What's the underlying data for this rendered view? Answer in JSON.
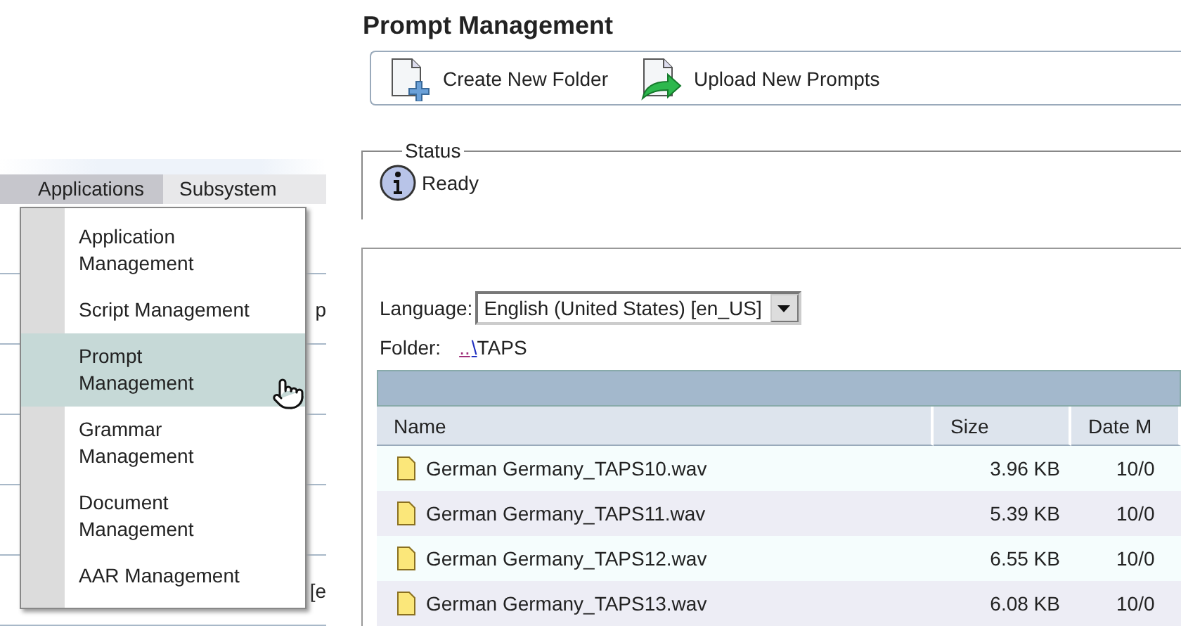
{
  "menu_bar": {
    "items": [
      {
        "label": "Applications",
        "selected": true
      },
      {
        "label": "Subsystem",
        "selected": false
      }
    ]
  },
  "behind_menu": [
    {
      "text": "p"
    },
    {
      "text": "[e"
    }
  ],
  "dropdown": {
    "items": [
      {
        "label": "Application Management",
        "selected": false
      },
      {
        "label": "Script Management",
        "selected": false
      },
      {
        "label": "Prompt Management",
        "selected": true
      },
      {
        "label": "Grammar Management",
        "selected": false
      },
      {
        "label": "Document Management",
        "selected": false
      },
      {
        "label": "AAR Management",
        "selected": false
      }
    ]
  },
  "page": {
    "title": "Prompt Management",
    "toolbar": [
      {
        "kind": "folder",
        "label": "Create New Folder"
      },
      {
        "kind": "upload",
        "label": "Upload New Prompts"
      }
    ],
    "status": {
      "legend": "Status",
      "text": "Ready"
    },
    "language": {
      "label": "Language:",
      "value": "English (United States) [en_US]"
    },
    "folder": {
      "label": "Folder:",
      "up_link": "..",
      "separator": "\\",
      "name": "TAPS"
    },
    "table": {
      "columns": [
        "Name",
        "Size",
        "Date M"
      ],
      "rows": [
        {
          "name": "German Germany_TAPS10.wav",
          "size": "3.96 KB",
          "column_3": "10/0"
        },
        {
          "name": "German Germany_TAPS11.wav",
          "size": "5.39 KB",
          "column_3": "10/0"
        },
        {
          "name": "German Germany_TAPS12.wav",
          "size": "6.55 KB",
          "column_3": "10/0"
        },
        {
          "name": "German Germany_TAPS13.wav",
          "size": "6.08 KB",
          "column_3": "10/0"
        }
      ]
    }
  }
}
